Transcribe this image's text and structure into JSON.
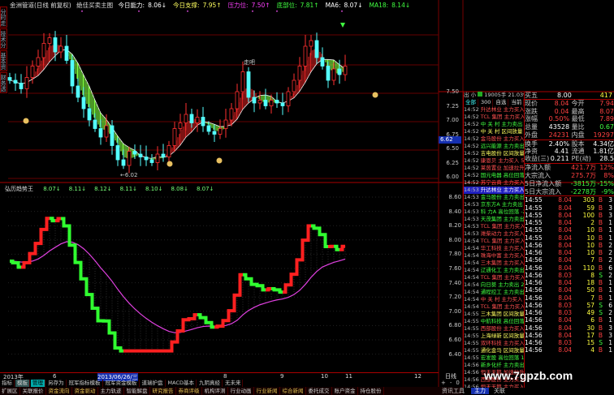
{
  "header": {
    "stock": "金洲管道(日线 前复权)",
    "indicator": "绝佳买卖主图",
    "items": [
      {
        "label": "今日能力:",
        "value": "8.06↓",
        "color": "#ffffff"
      },
      {
        "label": "今日支撑:",
        "value": "7.95↑",
        "color": "#ffff60"
      },
      {
        "label": "压力位:",
        "value": "7.50↑",
        "color": "#ff40ff"
      },
      {
        "label": "底部位:",
        "value": "7.81↑",
        "color": "#40ff40"
      },
      {
        "label": "MA6:",
        "value": "8.07↓",
        "color": "#ffffff"
      },
      {
        "label": "MA18:",
        "value": "8.14↓",
        "color": "#40ff40"
      }
    ]
  },
  "left_tabs": [
    "分时走势",
    "技术分析",
    "基本资料",
    "财务透视"
  ],
  "upper_chart": {
    "type": "candlestick",
    "y_ticks": [
      "7.50",
      "7.25",
      "7.00",
      "6.75",
      "6.50",
      "6.25",
      "6.00"
    ],
    "ylim": [
      6.0,
      7.5
    ],
    "closes": [
      7.7,
      7.65,
      7.55,
      7.75,
      7.95,
      8.1,
      8.35,
      8.45,
      8.2,
      8.3,
      8.05,
      7.6,
      7.4,
      7.2,
      7.0,
      6.85,
      6.7,
      6.9,
      6.55,
      6.3,
      6.2,
      6.45,
      6.4,
      6.35,
      6.3,
      6.25,
      6.4,
      6.35,
      6.55,
      6.85,
      6.95,
      7.1,
      6.95,
      7.05,
      6.9,
      6.8,
      6.75,
      6.85,
      7.0,
      7.2,
      7.5,
      7.85,
      7.4,
      7.3,
      7.35,
      7.25,
      7.35,
      7.3,
      7.25,
      7.5,
      7.7,
      7.95,
      8.3,
      8.4,
      8.1,
      7.95,
      7.7,
      7.9,
      7.8,
      7.95
    ],
    "low_annotation": "←6.02",
    "text_annotation": "走吧",
    "current_price_tag": "6.62",
    "colors": {
      "up": "#ff3030",
      "down": "#54ffff",
      "ribbon_up": "#d02020",
      "ribbon_down": "#80ff40"
    }
  },
  "lower_chart": {
    "title": "弘历趋势王",
    "values": [
      "8.07↓",
      "8.11↓",
      "8.12↓",
      "8.11↓",
      "8.10↓",
      "8.08↓",
      "8.07↓"
    ],
    "y_ticks": [
      "8.60",
      "8.40",
      "8.20",
      "8.00",
      "7.80",
      "7.60",
      "7.40",
      "7.20",
      "7.00",
      "6.80",
      "6.60",
      "6.40"
    ],
    "ylim": [
      6.4,
      8.6
    ]
  },
  "date_axis": {
    "labels": [
      "2013年",
      "6",
      "2013/06/26/三",
      "8",
      "9",
      "10",
      "11",
      "12"
    ],
    "period": "日线"
  },
  "indicator_tabs": [
    "指标",
    "模板",
    "管理",
    "另存为",
    "冠军指标模板",
    "冠军资金模板",
    "道瑞护盘",
    "MACD基本",
    "九阴真经",
    "无未来"
  ],
  "zoom_buttons": [
    "+",
    "-",
    "0"
  ],
  "bottom_tabs": [
    "扩展区",
    "关联报价",
    "资金流向",
    "资金驱动",
    "主力轨迹",
    "智能解盘",
    "研究报告",
    "券商评级",
    "机构评测",
    "行业动画",
    "行业新闻",
    "综合新闻",
    "委托成交",
    "账户资金",
    "持仓股份"
  ],
  "bottom_right": [
    "资讯工具",
    "主力",
    "关联"
  ],
  "watermark": "www.7gpzb.com",
  "ticklist": {
    "summary": [
      "出",
      "小",
      "19005手",
      "21.03%"
    ],
    "tabs": [
      "全部",
      "300",
      "自选",
      "当前",
      "设置",
      "滚出",
      "盘"
    ],
    "rows": [
      [
        "14:52",
        "升达林业",
        "主力买入",
        "6.90/",
        "b"
      ],
      [
        "14:52",
        "TCL 集团",
        "主力买入",
        "2.40/",
        "b"
      ],
      [
        "14:52",
        "中 关 村",
        "主力卖出",
        "6.32/",
        "s"
      ],
      [
        "14:52",
        "中 关 村",
        "区间放量",
        "1.833",
        "h"
      ],
      [
        "14:52",
        "金马股份",
        "主力买入",
        "6.65/",
        "b"
      ],
      [
        "14:52",
        "远兴能源",
        "主力卖出",
        "2.80/",
        "s"
      ],
      [
        "14:52",
        "吉电股份",
        "区间放量",
        "6.652",
        "h"
      ],
      [
        "14:52",
        "康恩贝",
        "主力买入",
        "5.53/",
        "b"
      ],
      [
        "14:52",
        "莱茵置业",
        "加速拉升",
        "2.40/",
        "b"
      ],
      [
        "14:52",
        "国元电器",
        "高位回落",
        "-2.09",
        "s"
      ],
      [
        "14:52",
        "苏宁云商",
        "主力买入",
        "6.88/",
        "b"
      ],
      [
        "14:53",
        "升达林业",
        "主力买入",
        "6.90/",
        "sel"
      ],
      [
        "14:53",
        "金马股份",
        "主力卖出",
        "4.87/",
        "s"
      ],
      [
        "14:53",
        "京东方A",
        "主力卖出",
        "2.14/",
        "s"
      ],
      [
        "14:53",
        "科 力A",
        "高位回落",
        "-2.55",
        "s"
      ],
      [
        "14:53",
        "天茂集团",
        "主力卖出",
        "6.18/",
        "s"
      ],
      [
        "14:53",
        "TCL 集团",
        "主力买入",
        "2.40/",
        "b"
      ],
      [
        "14:53",
        "潍柴动力",
        "主力买入",
        "6.32/",
        "b"
      ],
      [
        "14:54",
        "TCL 集团",
        "主力买入",
        "2.40/",
        "b"
      ],
      [
        "14:54",
        "华工科技",
        "主力买入",
        "5.17/",
        "b"
      ],
      [
        "14:54",
        "珠海中富",
        "主力买入",
        "5.53/",
        "b"
      ],
      [
        "14:54",
        "三木集团",
        "主力买入",
        "2.40/",
        "b"
      ],
      [
        "14:54",
        "辽通化工",
        "主力卖出",
        "3.64/",
        "s"
      ],
      [
        "14:54",
        "TCL 集团",
        "主力买入",
        "2.40/",
        "b"
      ],
      [
        "14:54",
        "向日葵",
        "主力卖出",
        "2.40/",
        "s"
      ],
      [
        "14:54",
        "通程控工",
        "主力卖出",
        "4.60/",
        "s"
      ],
      [
        "14:54",
        "中 关 村",
        "主力买入",
        "6.40/",
        "b"
      ],
      [
        "14:54",
        "TCL 集团",
        "主力买入",
        "2.40/",
        "b"
      ],
      [
        "14:55",
        "三木集团",
        "区间放量",
        "10.63",
        "h"
      ],
      [
        "14:55",
        "中航科技",
        "高位回落",
        "1.554",
        "s"
      ],
      [
        "14:55",
        "西部股份",
        "主力买入",
        "7.36/",
        "b"
      ],
      [
        "14:55",
        "上海绿新",
        "区间放量",
        "6.270",
        "h"
      ],
      [
        "14:55",
        "双环科技",
        "主力买入",
        "4.44/",
        "b"
      ],
      [
        "14:55",
        "通化金马",
        "区间放量",
        "6.060",
        "h"
      ],
      [
        "14:55",
        "宏发股",
        "高位回落",
        "1.67",
        "s"
      ],
      [
        "14:56",
        "新乡化纤",
        "主力卖出",
        "2.95/",
        "s"
      ],
      [
        "14:56",
        "恒天天鹅",
        "加速拉升",
        "7.74",
        "b"
      ],
      [
        "14:56",
        "西部股份",
        "主力买入",
        "1.57/",
        "b"
      ],
      [
        "14:56",
        "恒天天鹅",
        "主力买入",
        "3.67/",
        "b"
      ],
      [
        "14:56",
        "恒天天鹅",
        "",
        "",
        " b"
      ]
    ]
  },
  "quote": {
    "ask5": [
      "买五",
      "8.00",
      "417"
    ],
    "rows": [
      [
        "现价",
        "8.04",
        "今开",
        "7.94"
      ],
      [
        "涨跌",
        "0.04",
        "最高",
        "8.07"
      ],
      [
        "涨幅",
        "0.50%",
        "最低",
        "7.89"
      ],
      [
        "总量",
        "43528",
        "量比",
        "0.67"
      ],
      [
        "外盘",
        "24231",
        "内盘",
        "19297"
      ],
      [
        "换手",
        "2.40%",
        "股本",
        "4.34亿"
      ],
      [
        "净资",
        "4.41",
        "流通",
        "1.81亿"
      ],
      [
        "收益(三)",
        "0.211",
        "PE(动)",
        "28.5"
      ]
    ],
    "flows": [
      [
        "净流入额",
        "421.7万",
        "12%"
      ],
      [
        "大宗流入",
        "275.7万",
        "8%"
      ],
      [
        "5日净流入额",
        "-3815万",
        "-15%"
      ],
      [
        "5日大宗流入",
        "-2278万",
        "-9%"
      ]
    ],
    "ticks": [
      [
        "14:55",
        "8.04",
        "303",
        "B",
        "3"
      ],
      [
        "14:55",
        "8.04",
        "59",
        "B",
        "3"
      ],
      [
        "14:55",
        "8.04",
        "100",
        "B",
        "3"
      ],
      [
        "14:55",
        "8.04",
        "2",
        "B",
        "1"
      ],
      [
        "14:55",
        "8.04",
        "10",
        "B",
        "1"
      ],
      [
        "14:55",
        "8.04",
        "10",
        "B",
        "1"
      ],
      [
        "14:56",
        "8.04",
        "10",
        "B",
        "2"
      ],
      [
        "14:56",
        "8.04",
        "10",
        "B",
        "2"
      ],
      [
        "14:56",
        "8.04",
        "7",
        "B",
        "2"
      ],
      [
        "14:56",
        "8.04",
        "110",
        "B",
        "6"
      ],
      [
        "14:56",
        "8.03",
        "8",
        "S",
        "2"
      ],
      [
        "14:56",
        "8.04",
        "18",
        "B",
        "1"
      ],
      [
        "14:56",
        "8.04",
        "50",
        "B",
        "1"
      ],
      [
        "14:56",
        "8.04",
        "7",
        "B",
        "1"
      ],
      [
        "14:56",
        "8.03",
        "57",
        "S",
        "6"
      ],
      [
        "14:56",
        "8.03",
        "49",
        "S",
        "2"
      ],
      [
        "14:56",
        "8.04",
        "6",
        "B",
        "1"
      ],
      [
        "14:56",
        "8.04",
        "30",
        "B",
        "3"
      ],
      [
        "14:56",
        "8.04",
        "17",
        "B",
        "3"
      ],
      [
        "14:56",
        "8.03",
        "15",
        "S",
        "1"
      ],
      [
        "14:56",
        "8.04",
        "4",
        "B",
        "1"
      ]
    ]
  }
}
